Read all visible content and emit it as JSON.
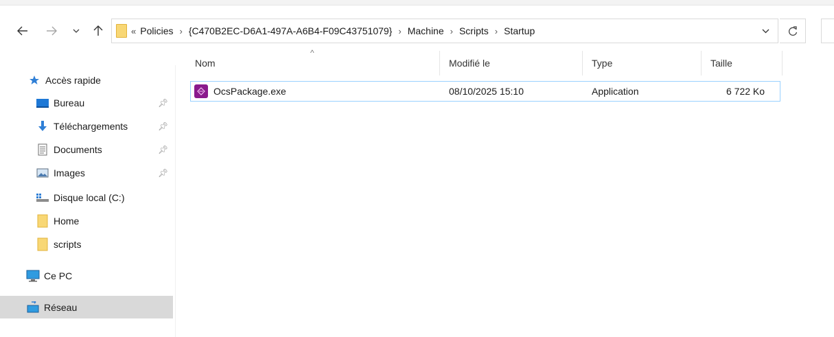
{
  "address_bar": {
    "overflow_marker": "«",
    "path": [
      "Policies",
      "{C470B2EC-D6A1-497A-A6B4-F09C43751079}",
      "Machine",
      "Scripts",
      "Startup"
    ]
  },
  "sidebar": {
    "items": [
      {
        "label": "Accès rapide",
        "icon": "star-icon"
      },
      {
        "label": "Bureau",
        "icon": "desktop-icon",
        "pinned": true
      },
      {
        "label": "Téléchargements",
        "icon": "download-arrow-icon",
        "pinned": true
      },
      {
        "label": "Documents",
        "icon": "document-icon",
        "pinned": true
      },
      {
        "label": "Images",
        "icon": "images-icon",
        "pinned": true
      },
      {
        "label": "Disque local (C:)",
        "icon": "drive-icon"
      },
      {
        "label": "Home",
        "icon": "folder-icon"
      },
      {
        "label": "scripts",
        "icon": "folder-icon"
      },
      {
        "label": "Ce PC",
        "icon": "computer-icon"
      },
      {
        "label": "Réseau",
        "icon": "network-icon",
        "selected": true
      }
    ]
  },
  "columns": {
    "name": "Nom",
    "modified": "Modifié le",
    "type": "Type",
    "size": "Taille"
  },
  "files": [
    {
      "name": "OcsPackage.exe",
      "modified": "08/10/2025 15:10",
      "type": "Application",
      "size": "6 722 Ko",
      "icon": "app-icon"
    }
  ],
  "colors": {
    "folder": "#f8d775",
    "selection_border": "#99d1ff",
    "selected_nav_bg": "#d9d9d9",
    "app_icon": "#8a1a8c"
  }
}
